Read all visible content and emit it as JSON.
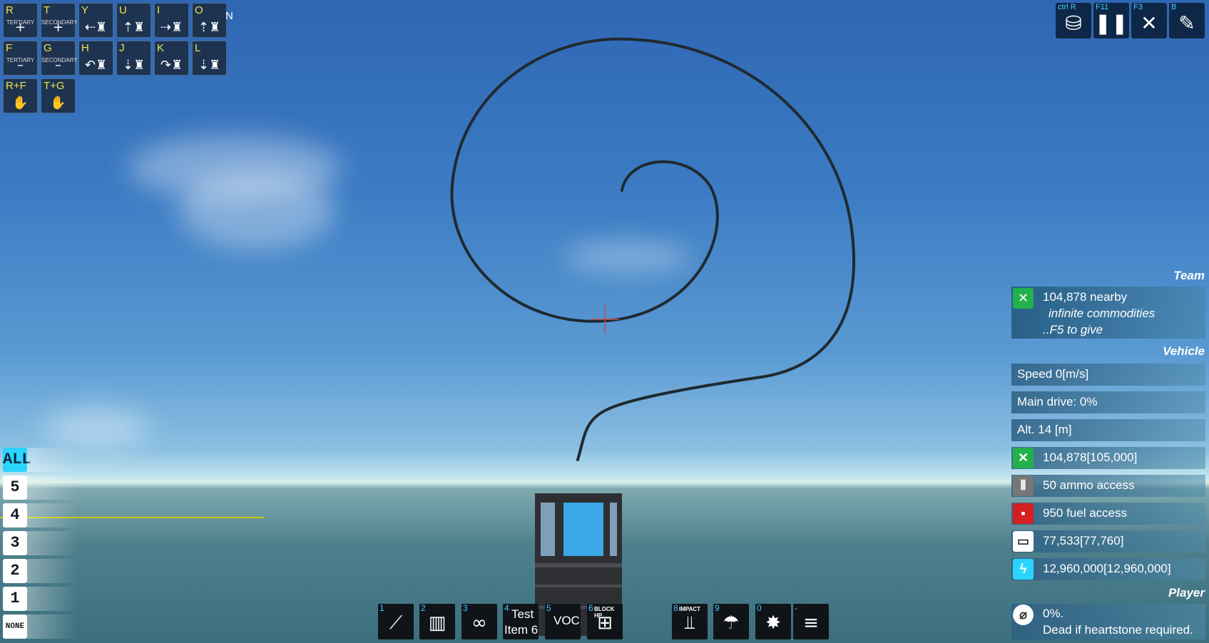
{
  "hotkeys": [
    {
      "key": "R",
      "sub": "TERTIARY",
      "icon": "+"
    },
    {
      "key": "T",
      "sub": "SECONDARY",
      "icon": "+"
    },
    {
      "key": "Y",
      "sub": "",
      "icon": "⇠♜"
    },
    {
      "key": "U",
      "sub": "",
      "icon": "⇡♜"
    },
    {
      "key": "I",
      "sub": "",
      "icon": "⇢♜"
    },
    {
      "key": "O",
      "sub": "",
      "icon": "⇡♜"
    },
    {
      "key": "F",
      "sub": "TERTIARY",
      "icon": "–"
    },
    {
      "key": "G",
      "sub": "SECONDARY",
      "icon": "–"
    },
    {
      "key": "H",
      "sub": "",
      "icon": "↶♜"
    },
    {
      "key": "J",
      "sub": "",
      "icon": "⇣♜"
    },
    {
      "key": "K",
      "sub": "",
      "icon": "↷♜"
    },
    {
      "key": "L",
      "sub": "",
      "icon": "⇣♜"
    },
    {
      "key": "R+F",
      "sub": "",
      "icon": "✋"
    },
    {
      "key": "T+G",
      "sub": "",
      "icon": "✋"
    }
  ],
  "compass_label": "N",
  "top_right": [
    {
      "key": "ctrl R",
      "icon": "resource-icon"
    },
    {
      "key": "F11",
      "icon": "pause-icon"
    },
    {
      "key": "F3",
      "icon": "tools-icon"
    },
    {
      "key": "B",
      "icon": "build-icon"
    }
  ],
  "team": {
    "section": "Team",
    "nearby": "104,878 nearby",
    "note1": "infinite commodities",
    "note2": "..F5 to give"
  },
  "vehicle": {
    "section": "Vehicle",
    "speed": "Speed 0[m/s]",
    "main_drive": "Main drive: 0%",
    "altitude": "Alt. 14 [m]",
    "materials": "104,878[105,000]",
    "ammo": "50 ammo access",
    "fuel": "950 fuel access",
    "energy": "77,533[77,760]",
    "power": "12,960,000[12,960,000]"
  },
  "player": {
    "section": "Player",
    "status": "0%.",
    "note": "Dead if heartstone required."
  },
  "levels": [
    "ALL",
    "5",
    "4",
    "3",
    "2",
    "1",
    "NONE"
  ],
  "hotbar": [
    {
      "num": "1",
      "cap": "",
      "icon": "rifle-icon",
      "glyph": "⟋"
    },
    {
      "num": "2",
      "cap": "",
      "icon": "minigun-icon",
      "glyph": "▥"
    },
    {
      "num": "3",
      "cap": "",
      "icon": "binoculars-icon",
      "glyph": "∞"
    },
    {
      "num": "4",
      "cap": "",
      "icon": "",
      "glyph": "",
      "text1": "Test",
      "text2": "Item 6"
    },
    {
      "num": "5",
      "cap": "",
      "icon": "",
      "glyph": "",
      "text1": "VOC",
      "text2": ""
    },
    {
      "num": "6",
      "cap": "BLOCK HP",
      "icon": "block-hp-icon",
      "glyph": "⊞"
    },
    {
      "num": "8",
      "cap": "IMPACT",
      "icon": "impact-icon",
      "glyph": "⫫"
    },
    {
      "num": "9",
      "cap": "",
      "icon": "repair-icon",
      "glyph": "☂"
    },
    {
      "num": "0",
      "cap": "",
      "icon": "drill-icon",
      "glyph": "✸"
    },
    {
      "num": "-",
      "cap": "",
      "icon": "weapons-icon",
      "glyph": "≡"
    }
  ],
  "colors": {
    "tile_bg": "#1d3350",
    "key_yellow": "#f0e24a",
    "hud_cyan": "#39d1ff",
    "mat_green": "#22b14c",
    "fuel_red": "#d42020",
    "power_cyan": "#2ad4ff"
  }
}
